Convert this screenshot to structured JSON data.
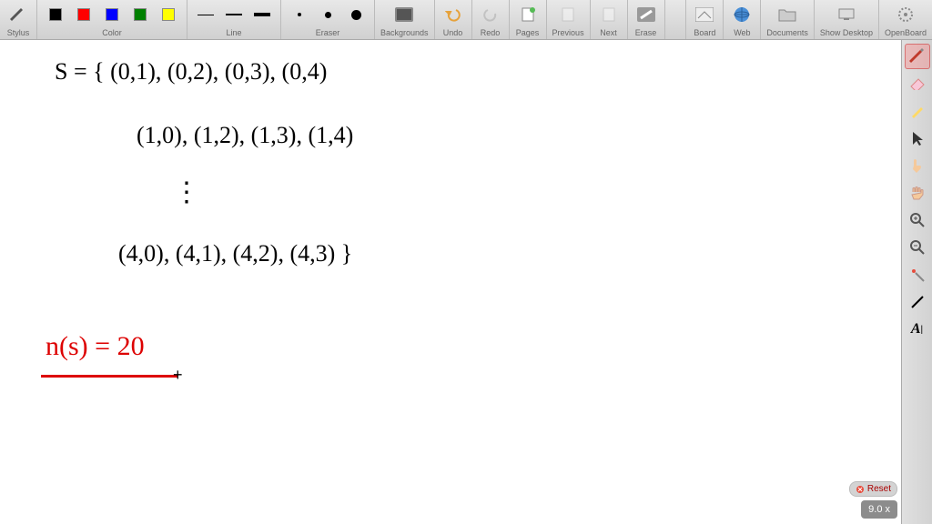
{
  "toolbar": {
    "stylus_label": "Stylus",
    "color_label": "Color",
    "line_label": "Line",
    "eraser_label": "Eraser",
    "backgrounds_label": "Backgrounds",
    "undo_label": "Undo",
    "redo_label": "Redo",
    "pages_label": "Pages",
    "previous_label": "Previous",
    "next_label": "Next",
    "erase_label": "Erase",
    "board_label": "Board",
    "web_label": "Web",
    "documents_label": "Documents",
    "show_desktop_label": "Show Desktop",
    "openboard_label": "OpenBoard",
    "colors": [
      "#000000",
      "#ff0000",
      "#0000ff",
      "#008000",
      "#ffff00"
    ]
  },
  "canvas": {
    "line1": "S = { (0,1),  (0,2),  (0,3),  (0,4)",
    "line2": "(1,0),  (1,2),  (1,3),  (1,4)",
    "ellipsis": "⋮",
    "line3": "(4,0),  (4,1),  (4,2),  (4,3) }",
    "result": "n(s) =  20"
  },
  "zoom": "9.0 x",
  "reset": "Reset"
}
